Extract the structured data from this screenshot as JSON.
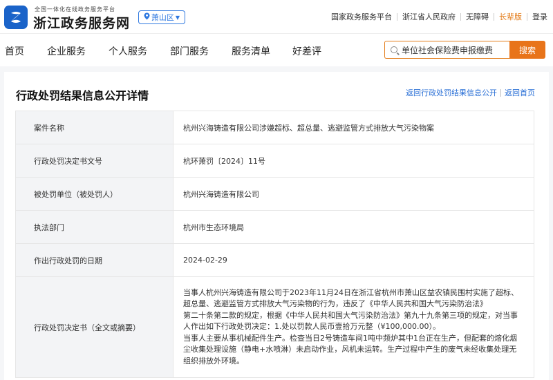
{
  "header": {
    "logo_icon": "zhe-logo-icon",
    "subtitle": "全国一体化在线政务服务平台",
    "title": "浙江政务服务网",
    "region": "萧山区",
    "links": [
      "国家政务服务平台",
      "浙江省人民政府",
      "无障碍",
      "长辈版",
      "登录"
    ]
  },
  "nav": {
    "items": [
      "首页",
      "企业服务",
      "个人服务",
      "部门服务",
      "服务清单",
      "好差评"
    ],
    "search_value": "单位社会保险费申报缴费",
    "search_button": "搜索"
  },
  "detail": {
    "title": "行政处罚结果信息公开详情",
    "link_back_list": "返回行政处罚结果信息公开",
    "link_home": "返回首页",
    "rows": [
      {
        "label": "案件名称",
        "value": "杭州兴海铸造有限公司涉嫌超标、超总量、逃避监管方式排放大气污染物案"
      },
      {
        "label": "行政处罚决定书文号",
        "value": "杭环萧罚〔2024〕11号"
      },
      {
        "label": "被处罚单位（被处罚人）",
        "value": "杭州兴海铸造有限公司"
      },
      {
        "label": "执法部门",
        "value": "杭州市生态环境局"
      },
      {
        "label": "作出行政处罚的日期",
        "value": "2024-02-29"
      }
    ],
    "full_text_label": "行政处罚决定书（全文或摘要）",
    "full_text_paragraphs": [
      "当事人杭州兴海铸造有限公司于2023年11月24日在浙江省杭州市萧山区益农镇民围村实施了超标、超总量、逃避监管方式排放大气污染物的行为，违反了《中华人民共和国大气污染防治法》",
      "第二十条第二款的规定，根据《中华人民共和国大气污染防治法》第九十九条第三项的规定，对当事人作出如下行政处罚决定：1.处以罚款人民币壹拾万元整（¥100,000.00）。",
      "当事人主要从事机械配件生产。检查当日2号铸造车间1吨中频炉其中1台正在生产，但配套的熔化烟尘收集处理设施（静电+水喷淋）未启动作业，风机未运转。生产过程中产生的废气未经收集处理无组织排放外环境。"
    ]
  },
  "colors": {
    "brand_blue": "#1a63c9",
    "link_blue": "#2a6fd6",
    "accent_orange": "#e8741a"
  }
}
